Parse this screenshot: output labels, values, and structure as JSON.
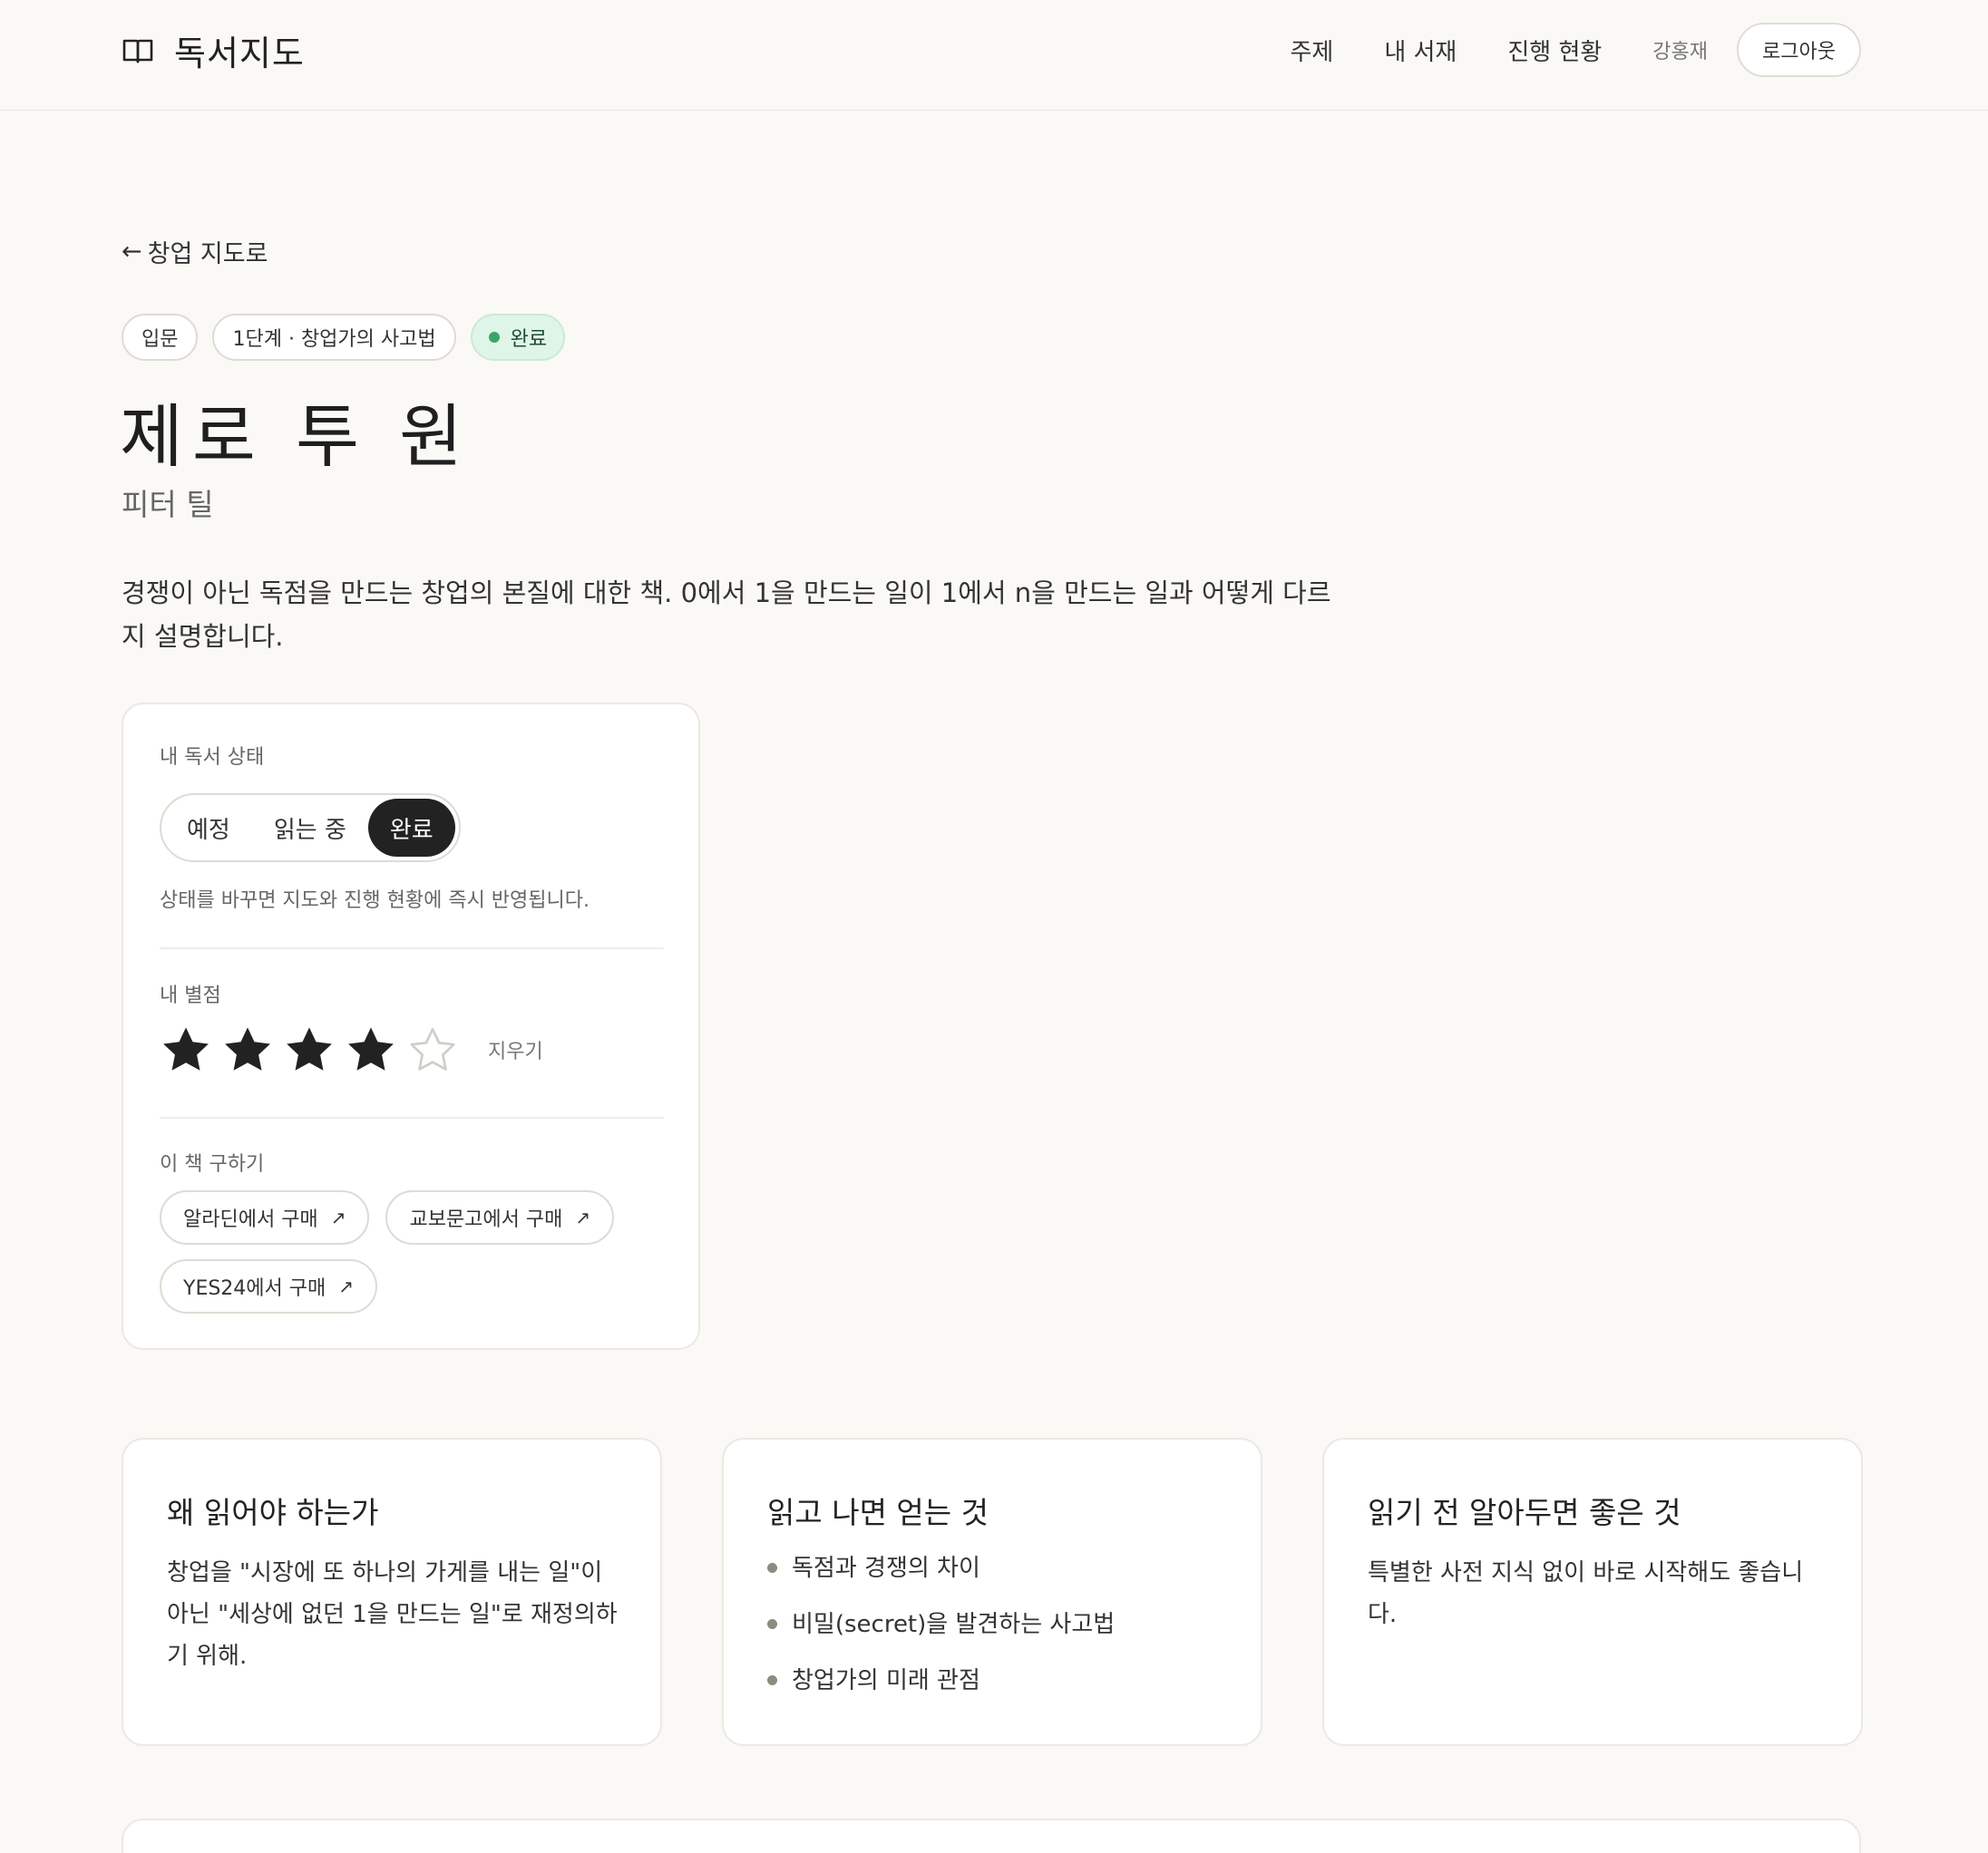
{
  "header": {
    "brand": "독서지도",
    "nav": [
      "주제",
      "내 서재",
      "진행 현황"
    ],
    "user": "강홍재",
    "logout": "로그아웃"
  },
  "back_link": "창업 지도로",
  "tags": {
    "level": "입문",
    "stage": "1단계 · 창업가의 사고법",
    "status": "완료"
  },
  "book": {
    "title": "제로 투 원",
    "author": "피터 틸",
    "description": "경쟁이 아닌 독점을 만드는 창업의 본질에 대한 책. 0에서 1을 만드는 일이 1에서 n을 만드는 일과 어떻게 다르지 설명합니다."
  },
  "status_card": {
    "status_label": "내 독서 상태",
    "options": [
      "예정",
      "읽는 중",
      "완료"
    ],
    "selected": "완료",
    "hint": "상태를 바꾸면 지도와 진행 현황에 즉시 반영됩니다.",
    "rating_label": "내 별점",
    "rating": 4,
    "rating_max": 5,
    "clear": "지우기",
    "buy_label": "이 책 구하기",
    "buy_links": [
      "알라딘에서 구매",
      "교보문고에서 구매",
      "YES24에서 구매"
    ]
  },
  "info": {
    "why": {
      "title": "왜 읽어야 하는가",
      "body": "창업을 \"시장에 또 하나의 가게를 내는 일\"이 아닌 \"세상에 없던 1을 만드는 일\"로 재정의하기 위해."
    },
    "gain": {
      "title": "읽고 나면 얻는 것",
      "items": [
        "독점과 경쟁의 차이",
        "비밀(secret)을 발견하는 사고법",
        "창업가의 미래 관점"
      ]
    },
    "before": {
      "title": "읽기 전 알아두면 좋은 것",
      "body": "특별한 사전 지식 없이 바로 시작해도 좋습니다."
    }
  }
}
